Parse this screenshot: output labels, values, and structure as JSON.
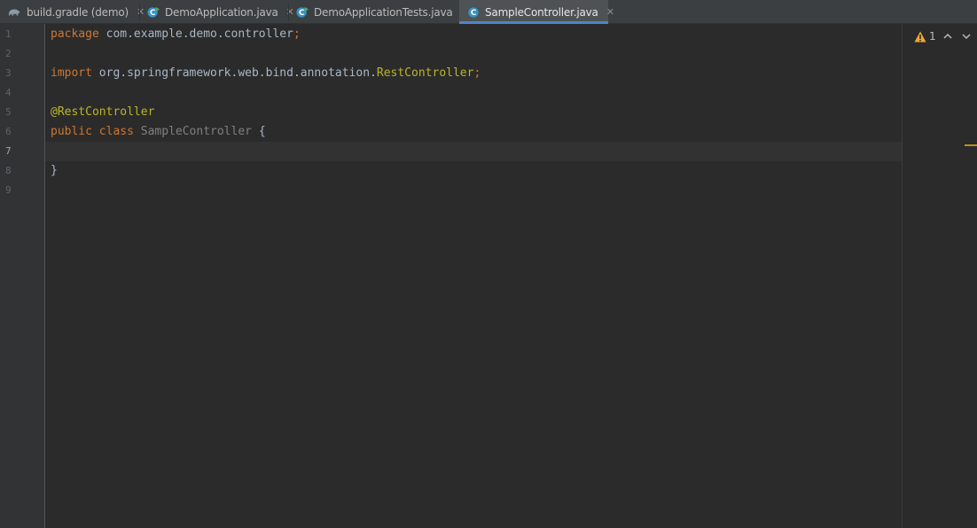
{
  "tabs": [
    {
      "label": "build.gradle (demo)",
      "icon": "gradle-elephant-icon",
      "active": false
    },
    {
      "label": "DemoApplication.java",
      "icon": "java-class-run-icon",
      "active": false
    },
    {
      "label": "DemoApplicationTests.java",
      "icon": "java-class-run-icon",
      "active": false
    },
    {
      "label": "SampleController.java",
      "icon": "java-class-icon",
      "active": true
    }
  ],
  "close_glyph": "✕",
  "inspection": {
    "warning_count": "1",
    "icon": "warning-triangle-icon"
  },
  "editor": {
    "current_line": 7,
    "lines": [
      {
        "num": "1",
        "tokens": [
          {
            "t": "package",
            "c": "kw"
          },
          {
            "t": " com.example.demo.controller",
            "c": ""
          },
          {
            "t": ";",
            "c": "semi"
          }
        ]
      },
      {
        "num": "2",
        "tokens": []
      },
      {
        "num": "3",
        "tokens": [
          {
            "t": "import",
            "c": "kw"
          },
          {
            "t": " org.springframework.web.bind.annotation.",
            "c": ""
          },
          {
            "t": "RestController",
            "c": "imp-cls"
          },
          {
            "t": ";",
            "c": "semi"
          }
        ]
      },
      {
        "num": "4",
        "tokens": []
      },
      {
        "num": "5",
        "tokens": [
          {
            "t": "@RestController",
            "c": "ann"
          }
        ]
      },
      {
        "num": "6",
        "tokens": [
          {
            "t": "public",
            "c": "kw"
          },
          {
            "t": " ",
            "c": ""
          },
          {
            "t": "class",
            "c": "kw"
          },
          {
            "t": " ",
            "c": ""
          },
          {
            "t": "SampleController",
            "c": "cls"
          },
          {
            "t": " {",
            "c": ""
          }
        ]
      },
      {
        "num": "7",
        "tokens": []
      },
      {
        "num": "8",
        "tokens": [
          {
            "t": "}",
            "c": ""
          }
        ]
      },
      {
        "num": "9",
        "tokens": []
      }
    ]
  },
  "colors": {
    "keyword": "#cc7832",
    "annotation": "#bbb529",
    "plain": "#a9b7c6",
    "unused_class": "#808080",
    "active_tab_underline": "#4a88c7",
    "warning": "#be9117"
  }
}
